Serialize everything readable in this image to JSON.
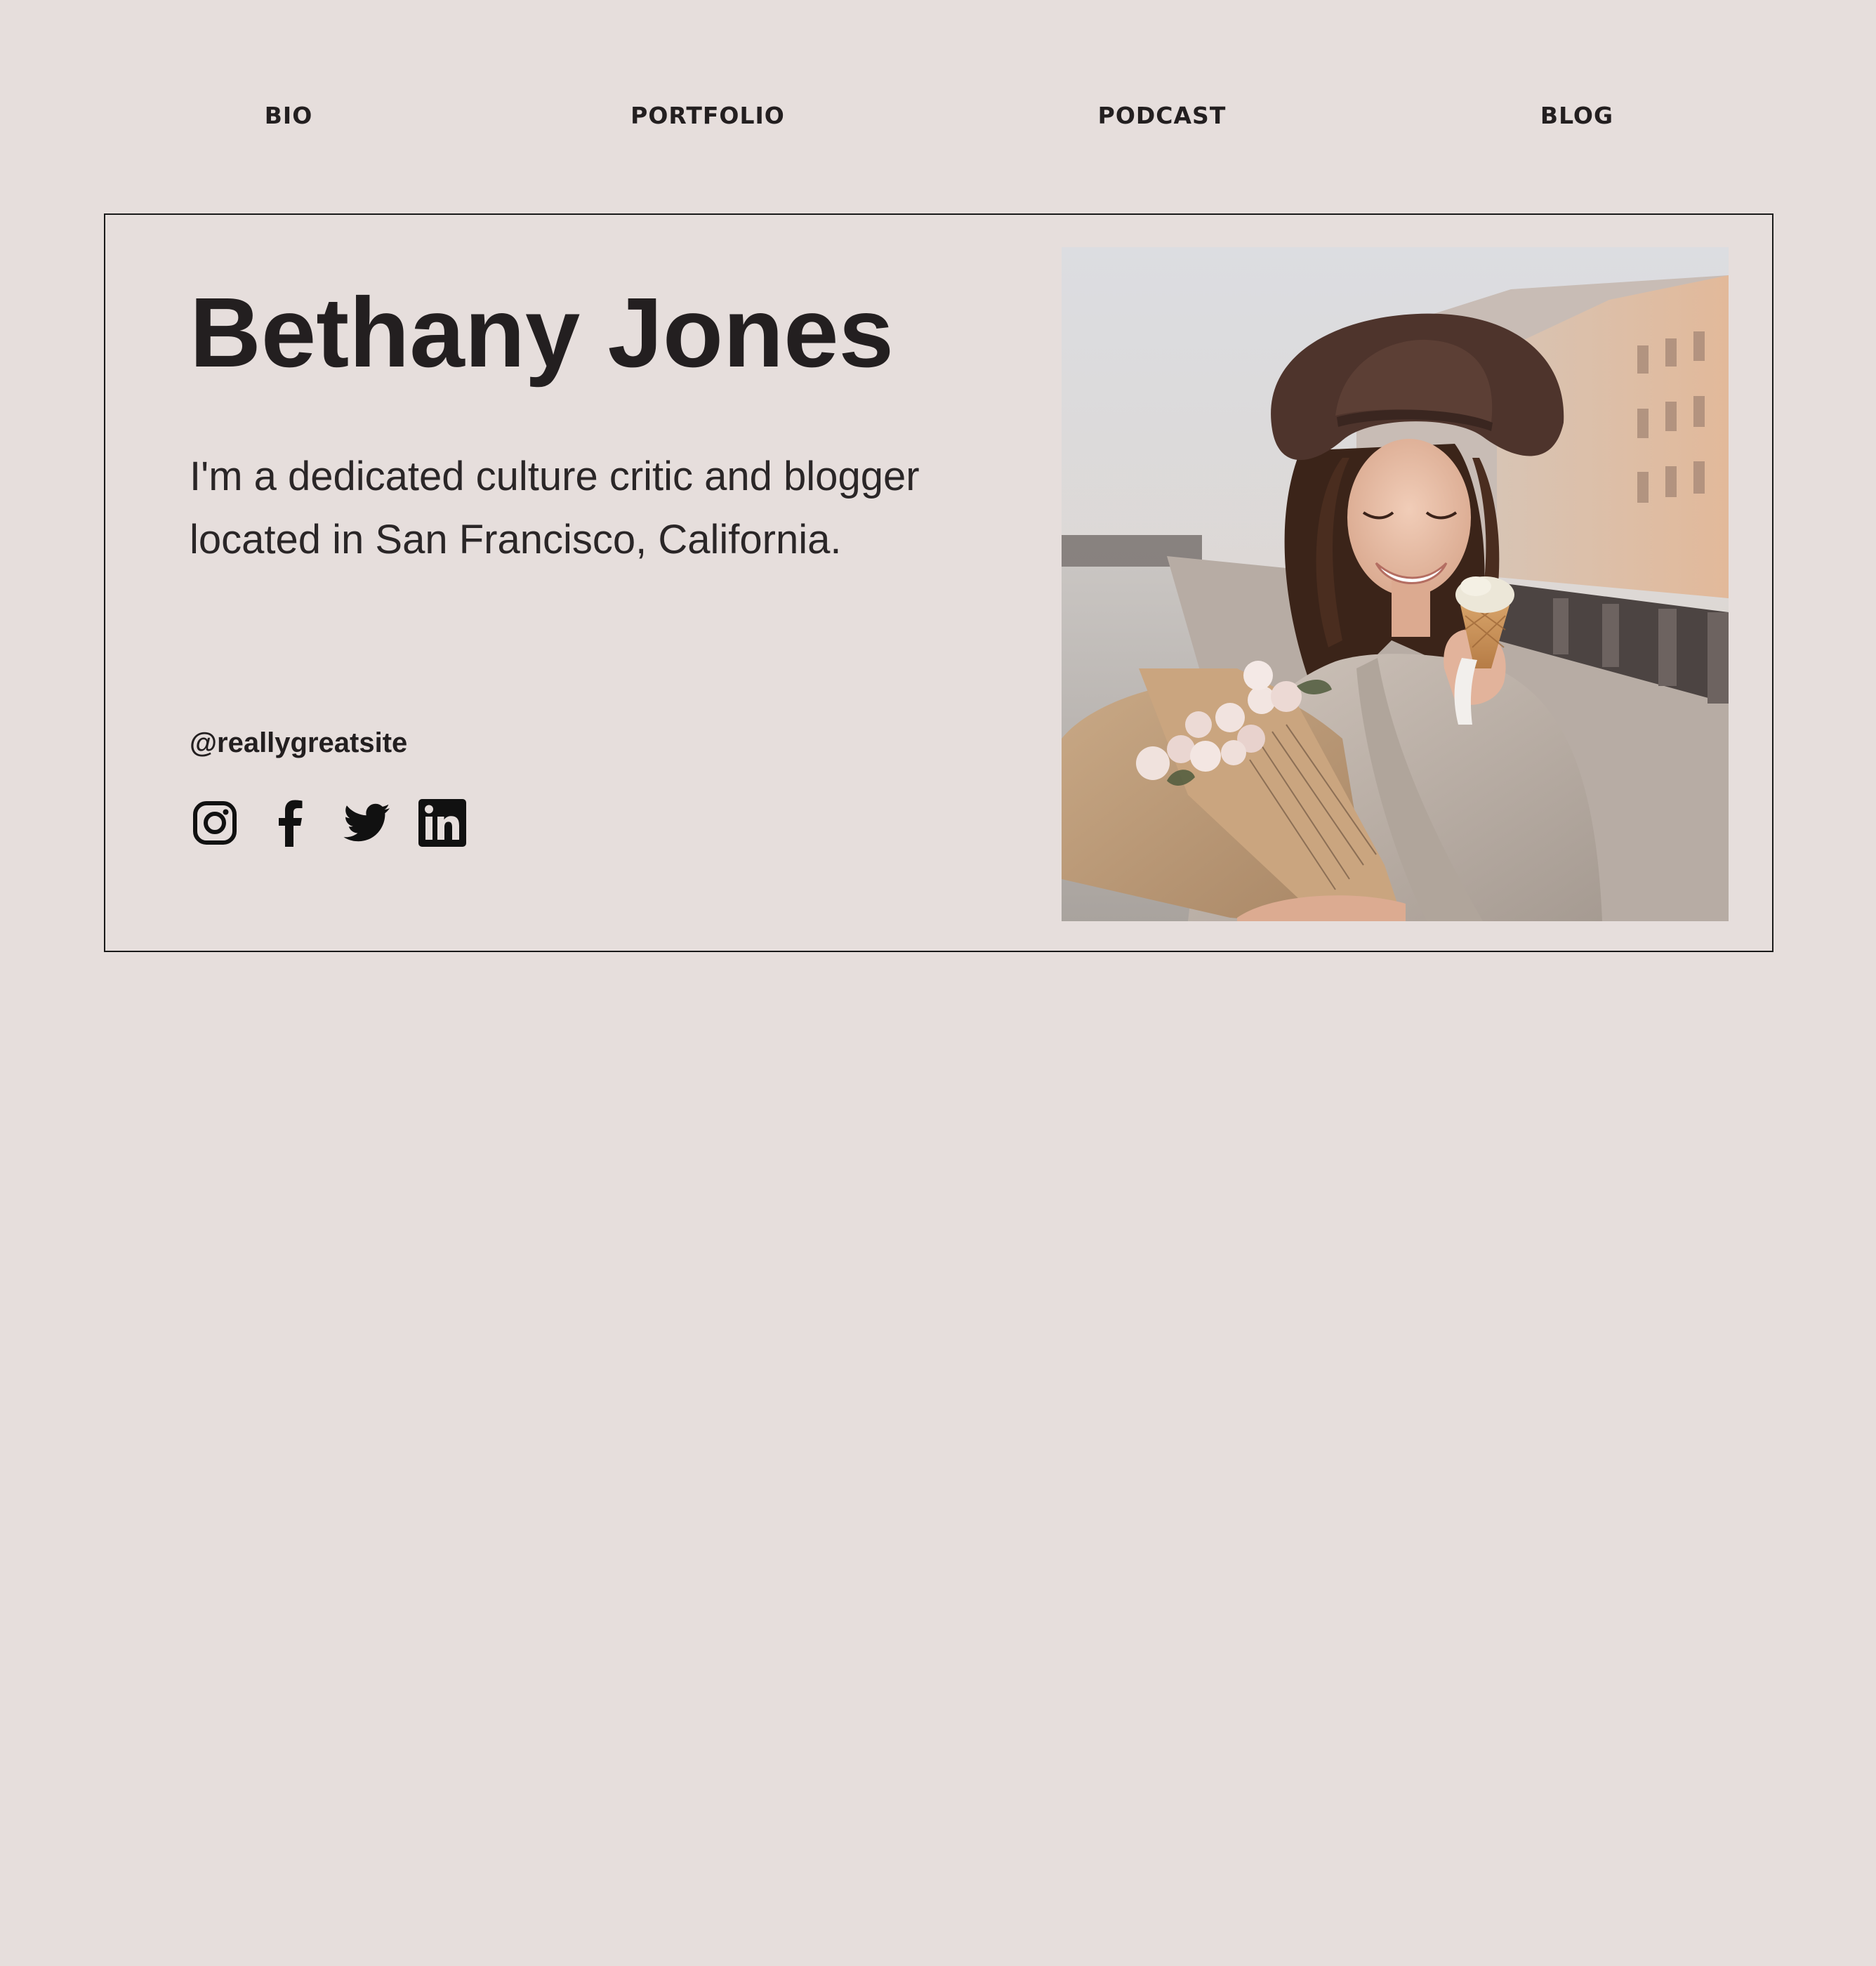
{
  "nav": {
    "items": [
      {
        "label": "BIO"
      },
      {
        "label": "PORTFOLIO"
      },
      {
        "label": "PODCAST"
      },
      {
        "label": "BLOG"
      }
    ]
  },
  "profile": {
    "name": "Bethany Jones",
    "bio": "I'm a dedicated culture critic and blogger located in San Francisco, California.",
    "handle": "@reallygreatsite"
  },
  "social": [
    {
      "icon": "instagram-icon"
    },
    {
      "icon": "facebook-icon"
    },
    {
      "icon": "twitter-icon"
    },
    {
      "icon": "linkedin-icon"
    }
  ],
  "colors": {
    "background": "#e6dedc",
    "text": "#231f20",
    "border": "#1a1a1a"
  }
}
